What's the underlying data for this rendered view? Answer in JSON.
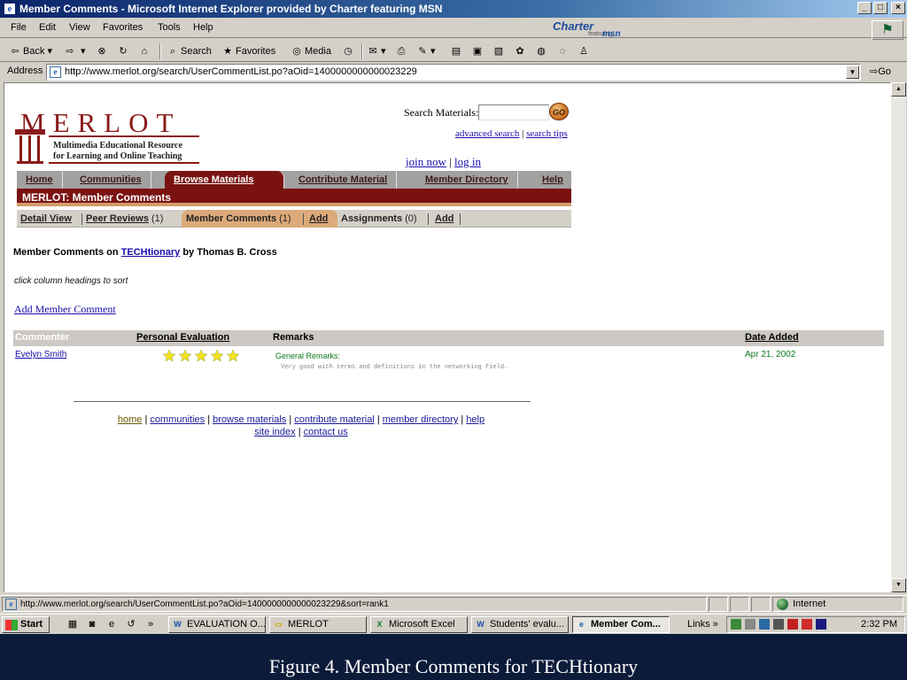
{
  "window": {
    "title": "Member Comments - Microsoft Internet Explorer provided by Charter featuring MSN"
  },
  "menu": [
    "File",
    "Edit",
    "View",
    "Favorites",
    "Tools",
    "Help"
  ],
  "brand": {
    "charter": "Charter",
    "featuring": "featuring",
    "msn": "msn"
  },
  "toolbar": {
    "back": "Back",
    "search": "Search",
    "favorites": "Favorites",
    "media": "Media"
  },
  "address": {
    "label": "Address",
    "url": "http://www.merlot.org/search/UserCommentList.po?aOid=1400000000000023229",
    "go": "Go"
  },
  "merlot": {
    "logo_letters": "MERLOT",
    "logo_sub1": "Multimedia Educational Resource",
    "logo_sub2": "for Learning and Online Teaching",
    "search_label": "Search Materials:",
    "go": "GO",
    "advanced_search": "advanced search",
    "search_tips": "search tips",
    "join_now": "join now",
    "log_in": "log in",
    "nav": [
      "Home",
      "Communities",
      "Browse Materials",
      "Contribute Material",
      "Member Directory",
      "Help"
    ],
    "section_title": "MERLOT: Member Comments",
    "subnav": {
      "detail_view": "Detail View",
      "peer_reviews": "Peer Reviews",
      "peer_reviews_count": "(1)",
      "member_comments": "Member Comments",
      "member_comments_count": "(1)",
      "add1": "Add",
      "assignments": "Assignments",
      "assignments_count": "(0)",
      "add2": "Add"
    },
    "heading_prefix": "Member Comments on",
    "heading_link": "TECHtionary",
    "heading_suffix": "by Thomas B. Cross",
    "hint": "click column headings to sort",
    "add_comment": "Add Member Comment",
    "table": {
      "headers": [
        "Commenter",
        "Personal Evaluation",
        "Remarks",
        "Date Added"
      ],
      "rows": [
        {
          "commenter": "Evelyn Smith",
          "rating": 5,
          "remark_title": "General Remarks:",
          "remark_text": "Very good with terms and definitions in the networking field.",
          "date": "Apr 21, 2002"
        }
      ]
    },
    "footer1": [
      "home",
      "communities",
      "browse materials",
      "contribute material",
      "member directory",
      "help"
    ],
    "footer2": [
      "site index",
      "contact us"
    ]
  },
  "status": {
    "url": "http://www.merlot.org/search/UserCommentList.po?aOid=1400000000000023229&sort=rank1",
    "zone": "Internet"
  },
  "taskbar": {
    "start": "Start",
    "tasks": [
      "EVALUATION O...",
      "MERLOT",
      "Microsoft Excel",
      "Students' evalu...",
      "Member Com..."
    ],
    "links": "Links",
    "clock": "2:32 PM"
  },
  "caption": "Figure 4. Member Comments for TECHtionary"
}
